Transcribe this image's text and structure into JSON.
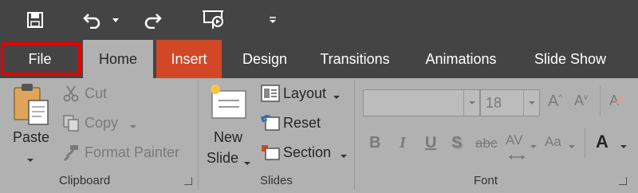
{
  "qat": {
    "save_icon": "save-icon",
    "undo_icon": "undo-icon",
    "redo_icon": "redo-icon",
    "present_icon": "present-from-beginning-icon",
    "customize_icon": "customize-qat-icon"
  },
  "tabs": {
    "file": "File",
    "home": "Home",
    "insert": "Insert",
    "design": "Design",
    "transitions": "Transitions",
    "animations": "Animations",
    "slideshow": "Slide Show"
  },
  "clipboard": {
    "paste": "Paste",
    "cut": "Cut",
    "copy": "Copy",
    "format_painter": "Format Painter",
    "group_label": "Clipboard"
  },
  "slides": {
    "new_slide_1": "New",
    "new_slide_2": "Slide",
    "layout": "Layout",
    "reset": "Reset",
    "section": "Section",
    "group_label": "Slides"
  },
  "font": {
    "font_name": "",
    "font_size": "18",
    "grow": "A",
    "shrink": "A",
    "bold": "B",
    "italic": "I",
    "underline": "U",
    "shadow": "S",
    "strike": "abc",
    "spacing": "AV",
    "case": "Aa",
    "color": "A",
    "group_label": "Font"
  },
  "colors": {
    "title_bar": "#444444",
    "ribbon": "#b1b1b1",
    "insert_tab": "#d24726",
    "highlight_outline": "#e60000"
  }
}
